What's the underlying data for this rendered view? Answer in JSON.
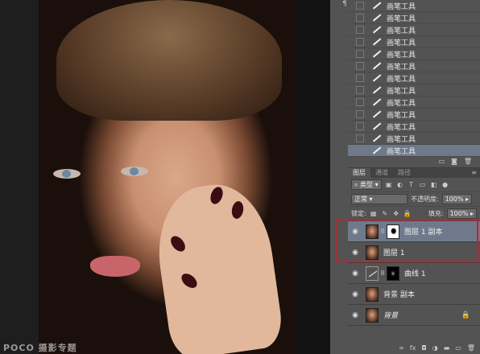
{
  "canvas": {
    "watermark": "POCO 摄影专题"
  },
  "history": {
    "items": [
      "画笔工具",
      "画笔工具",
      "画笔工具",
      "画笔工具",
      "画笔工具",
      "画笔工具",
      "画笔工具",
      "画笔工具",
      "画笔工具",
      "画笔工具",
      "画笔工具",
      "画笔工具",
      "画笔工具"
    ],
    "selected_index": 12
  },
  "layers": {
    "tabs": [
      "图层",
      "通道",
      "路径"
    ],
    "kind_filter": "类型",
    "blend_mode": "正常",
    "opacity_label": "不透明度:",
    "opacity_value": "100%",
    "lock_label": "锁定:",
    "fill_label": "填充:",
    "fill_value": "100%",
    "rows": [
      {
        "name": "图层 1 副本",
        "selected": true
      },
      {
        "name": "图层 1",
        "selected": false
      },
      {
        "name": "曲线 1",
        "selected": false
      },
      {
        "name": "背景 副本",
        "selected": false
      },
      {
        "name": "背景",
        "selected": false
      }
    ]
  },
  "colors": {
    "selection": "#6e7a8c",
    "highlight": "#c8202a",
    "panel": "#535353"
  }
}
